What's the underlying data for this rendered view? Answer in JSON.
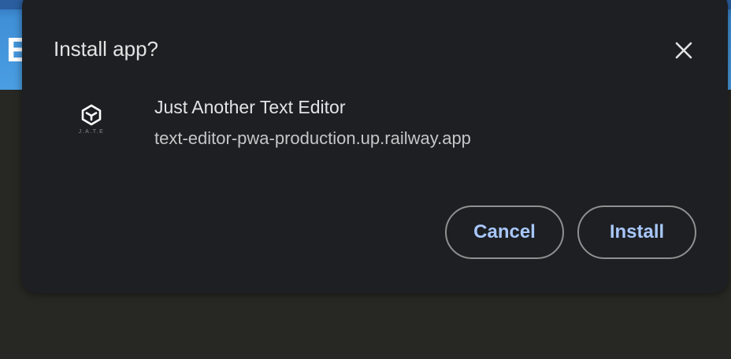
{
  "background": {
    "header_letter": "E"
  },
  "dialog": {
    "title": "Install app?",
    "close_icon": "close-icon",
    "app": {
      "icon": "jate-logo-icon",
      "icon_caption": "J.A.T.E",
      "name": "Just Another Text Editor",
      "origin": "text-editor-pwa-production.up.railway.app"
    },
    "buttons": {
      "cancel_label": "Cancel",
      "install_label": "Install"
    }
  },
  "colors": {
    "dialog_bg": "#1d1f23",
    "title_text": "#e3e3e3",
    "button_text": "#a8c7fa",
    "button_border": "#8e918f",
    "page_bg": "#272723",
    "header_blue": "#4a9ee2"
  }
}
